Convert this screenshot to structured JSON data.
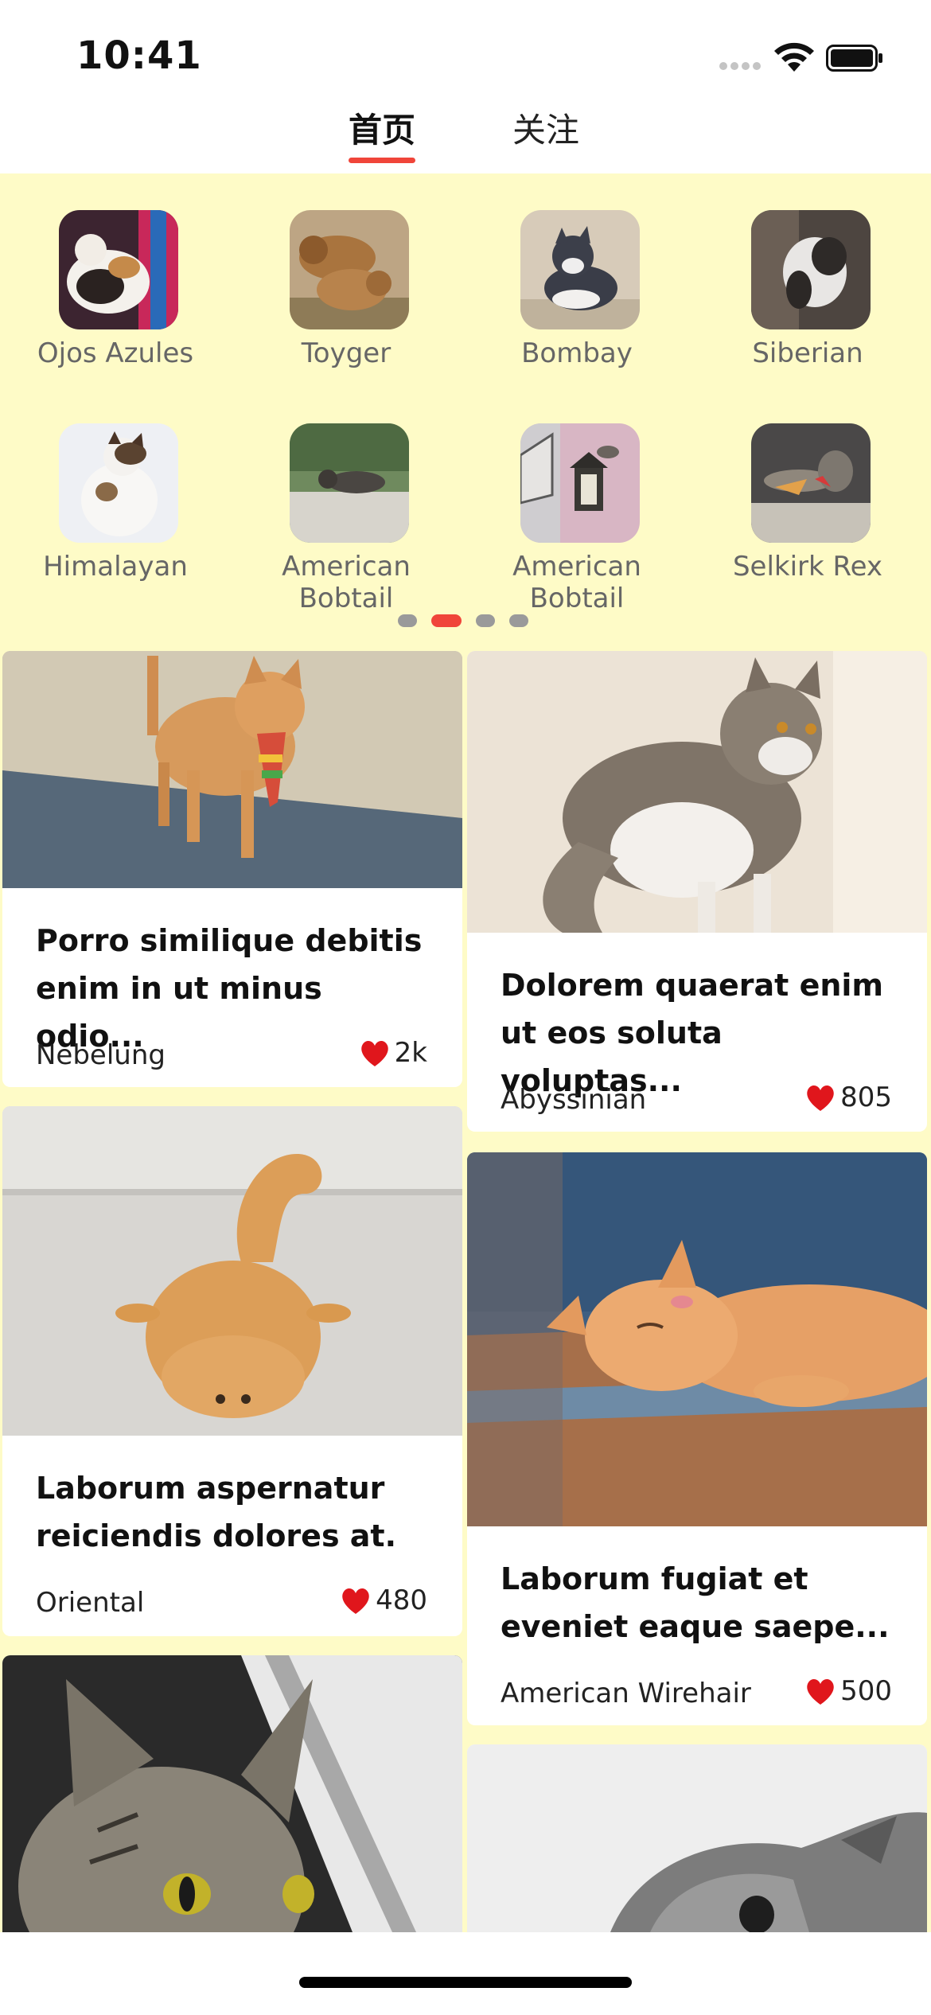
{
  "status_bar": {
    "time": "10:41"
  },
  "tabs": [
    {
      "label": "首页",
      "active": true
    },
    {
      "label": "关注",
      "active": false
    }
  ],
  "breeds": [
    {
      "name": "Ojos Azules",
      "icon": "cat-photo"
    },
    {
      "name": "Toyger",
      "icon": "cat-photo"
    },
    {
      "name": "Bombay",
      "icon": "cat-photo"
    },
    {
      "name": "Siberian",
      "icon": "cat-photo"
    },
    {
      "name": "Himalayan",
      "icon": "cat-photo"
    },
    {
      "name": "American Bobtail",
      "icon": "cat-photo"
    },
    {
      "name": "American Bobtail",
      "icon": "cat-photo"
    },
    {
      "name": "Selkirk Rex",
      "icon": "cat-photo"
    }
  ],
  "pager": {
    "pages": 4,
    "current": 2
  },
  "posts": [
    {
      "title": "Porro similique debitis\nenim in ut minus odio...",
      "breed": "Nebelung",
      "likes": "2k"
    },
    {
      "title": "Dolorem quaerat enim\nut eos soluta voluptas...",
      "breed": "Abyssinian",
      "likes": "805"
    },
    {
      "title": "Laborum aspernatur\nreiciendis dolores at.",
      "breed": "Oriental",
      "likes": "480"
    },
    {
      "title": "Laborum fugiat et\neveniet eaque saepe...",
      "breed": "American Wirehair",
      "likes": "500"
    }
  ],
  "colors": {
    "accent": "#f0453a",
    "feed_background": "#fefbc7",
    "heart": "#e0161c"
  }
}
